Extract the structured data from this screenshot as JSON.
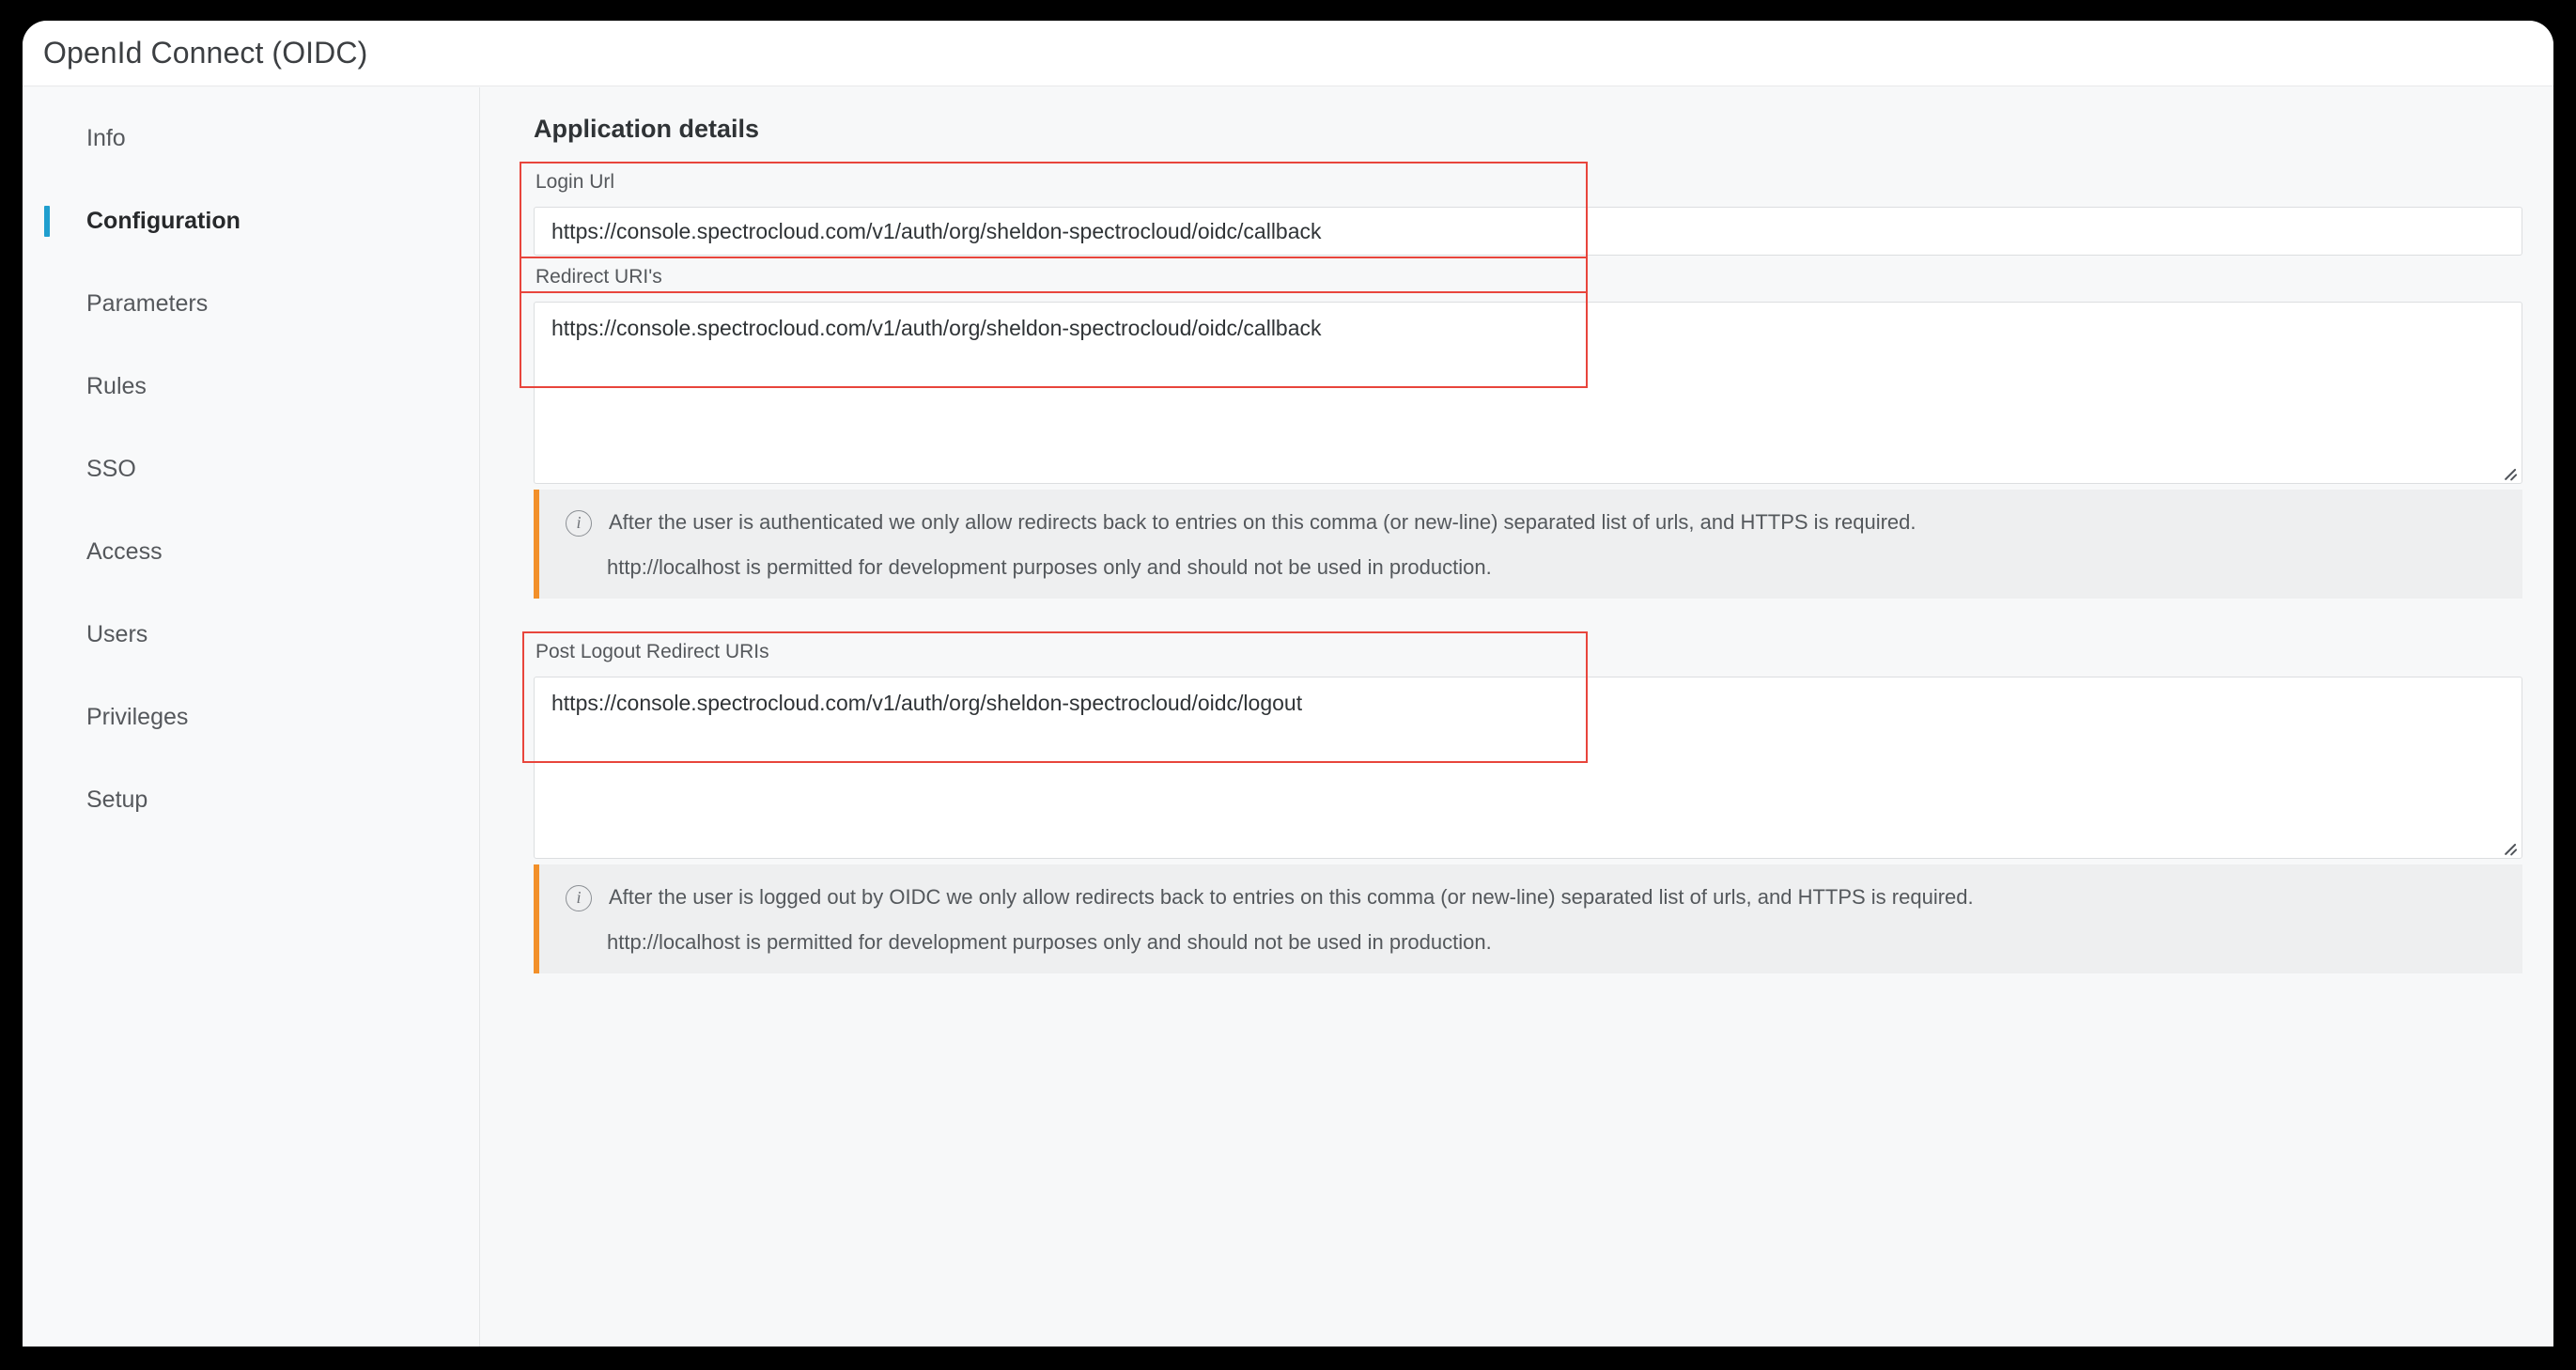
{
  "window": {
    "title": "OpenId Connect (OIDC)"
  },
  "sidebar": {
    "items": [
      {
        "label": "Info",
        "active": false
      },
      {
        "label": "Configuration",
        "active": true
      },
      {
        "label": "Parameters",
        "active": false
      },
      {
        "label": "Rules",
        "active": false
      },
      {
        "label": "SSO",
        "active": false
      },
      {
        "label": "Access",
        "active": false
      },
      {
        "label": "Users",
        "active": false
      },
      {
        "label": "Privileges",
        "active": false
      },
      {
        "label": "Setup",
        "active": false
      }
    ]
  },
  "main": {
    "section_title": "Application details",
    "login_url": {
      "label": "Login Url",
      "value": "https://console.spectrocloud.com/v1/auth/org/sheldon-spectrocloud/oidc/callback"
    },
    "redirect_uris": {
      "label": "Redirect URI's",
      "value": "https://console.spectrocloud.com/v1/auth/org/sheldon-spectrocloud/oidc/callback"
    },
    "redirect_note": {
      "line1": "After the user is authenticated we only allow redirects back to entries on this comma (or new-line) separated list of urls, and HTTPS is required.",
      "line2": "http://localhost is permitted for development purposes only and should not be used in production.",
      "icon": "info-icon"
    },
    "post_logout_redirect_uris": {
      "label": "Post Logout Redirect URIs",
      "value": "https://console.spectrocloud.com/v1/auth/org/sheldon-spectrocloud/oidc/logout"
    },
    "logout_note": {
      "line1": "After the user is logged out by OIDC we only allow redirects back to entries on this comma (or new-line) separated list of urls, and HTTPS is required.",
      "line2": "http://localhost is permitted for development purposes only and should not be used in production.",
      "icon": "info-icon"
    }
  },
  "colors": {
    "accent_active": "#1f9ece",
    "note_accent": "#f2902a",
    "highlight_box": "#e8453c",
    "page_bg": "#f7f8f9"
  }
}
